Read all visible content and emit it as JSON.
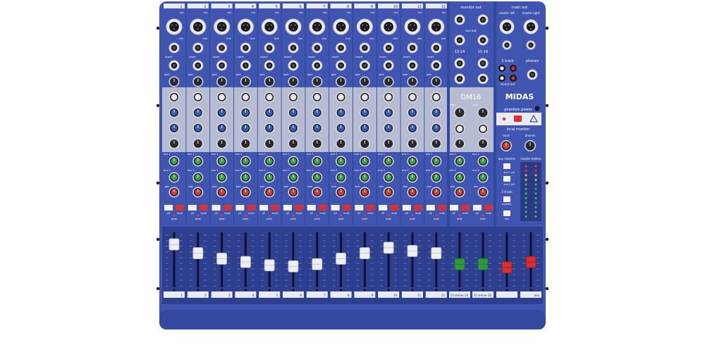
{
  "mixer": {
    "model": "DM16",
    "brand": "MIDAS",
    "body_color": "#3f55b0",
    "channel_numbers": [
      "1",
      "2",
      "3",
      "4",
      "5",
      "6",
      "7",
      "8",
      "9",
      "10",
      "11",
      "12"
    ],
    "labels": {
      "mic": "mic",
      "line": "line",
      "insert": "insert",
      "gain": "gain",
      "aux1": "aux 1",
      "aux2": "aux 2",
      "pan": "pan",
      "pfl": "pfl",
      "mute": "mute",
      "peak": "peak"
    },
    "stereo_inputs": [
      "13-14",
      "15-16"
    ],
    "section_titles": {
      "monitor_out": "monitor out",
      "main_out": "main out",
      "master_left": "master left",
      "master_right": "master right",
      "aux_out": "aux out",
      "two_track": "2 track",
      "record_out": "record out",
      "phones": "phones",
      "phantom_power": "phantom power",
      "local_monitor": "local monitor",
      "local": "local",
      "aux_masters": "aux masters",
      "master_meters": "master meters",
      "aux1_pfl": "aux 1 pfl",
      "aux2_pfl": "aux 2 pfl",
      "two_track_btn": "2 track",
      "monitor": "monitor",
      "mix": "mix"
    },
    "fader_labels": [
      "1",
      "2",
      "3",
      "4",
      "5",
      "6",
      "7",
      "8",
      "9",
      "10",
      "11",
      "12",
      "13 stereo 14",
      "15 stereo 16",
      "",
      "mix"
    ],
    "fader_levels": [
      0.78,
      0.62,
      0.52,
      0.46,
      0.4,
      0.38,
      0.42,
      0.52,
      0.62,
      0.72,
      0.66,
      0.62,
      0.42,
      0.42,
      0.36,
      0.46
    ]
  }
}
